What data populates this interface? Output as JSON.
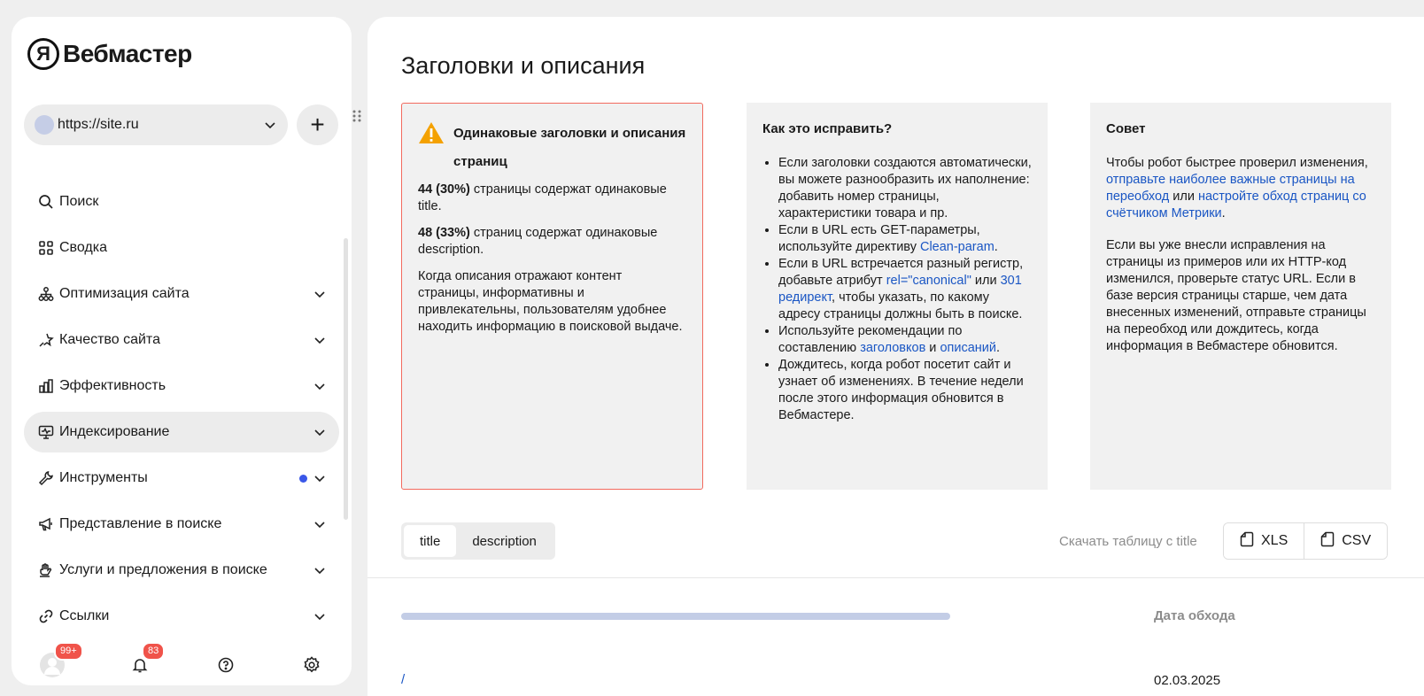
{
  "app": {
    "logo_letter": "Я",
    "logo_text": "Вебмастер"
  },
  "site_select": {
    "url": "https://site.ru",
    "add_label": "+"
  },
  "nav": {
    "items": [
      {
        "label": "Поиск",
        "icon": "search-icon"
      },
      {
        "label": "Сводка",
        "icon": "grid-icon"
      },
      {
        "label": "Оптимизация сайта",
        "icon": "sitemap-icon"
      },
      {
        "label": "Качество сайта",
        "icon": "magic-star-icon"
      },
      {
        "label": "Эффективность",
        "icon": "bar-chart-icon"
      },
      {
        "label": "Индексирование",
        "icon": "monitor-pulse-icon"
      },
      {
        "label": "Инструменты",
        "icon": "wrench-icon"
      },
      {
        "label": "Представление в поиске",
        "icon": "megaphone-icon"
      },
      {
        "label": "Услуги и предложения в поиске",
        "icon": "hand-icon"
      },
      {
        "label": "Ссылки",
        "icon": "link-icon"
      }
    ]
  },
  "bottom_bar": {
    "profile_badge": "99+",
    "notifications_badge": "83"
  },
  "page": {
    "title": "Заголовки и описания"
  },
  "warning_card": {
    "title": "Одинаковые заголовки и описания страниц",
    "stat1_bold": "44 (30%)",
    "stat1_text": " страницы содержат одинаковые title.",
    "stat2_bold": "48 (33%)",
    "stat2_text": " страниц содержат одинаковые description.",
    "body": "Когда описания отражают контент страницы, информативны и привлекательны, пользователям удобнее находить информацию в поисковой выдаче."
  },
  "fix_card": {
    "title": "Как это исправить?",
    "li1": "Если заголовки создаются автоматически, вы можете разнообразить их наполнение: добавить номер страницы, характеристики товара и пр.",
    "li2_a": "Если в URL есть GET-параметры, используйте директиву ",
    "li2_link": "Clean-param",
    "li2_b": ".",
    "li3_a": "Если в URL встречается разный регистр, добавьте атрибут ",
    "li3_link1": "rel=\"canonical\"",
    "li3_b": " или ",
    "li3_link2": "301 редирект",
    "li3_c": ", чтобы указать, по какому адресу страницы должны быть в поиске.",
    "li4_a": "Используйте рекомендации по составлению ",
    "li4_link1": "заголовков",
    "li4_b": " и ",
    "li4_link2": "описаний",
    "li4_c": ".",
    "li5": "Дождитесь, когда робот посетит сайт и узнает об изменениях. В течение недели после этого информация обновится в Вебмастере."
  },
  "tip_card": {
    "title": "Совет",
    "p1_a": "Чтобы робот быстрее проверил изменения, ",
    "p1_link1": "отправьте наиболее важные страницы на переобход",
    "p1_b": " или ",
    "p1_link2": "настройте обход страниц со счётчиком Метрики",
    "p1_c": ".",
    "p2": "Если вы уже внесли исправления на страницы из примеров или их HTTP-код изменился, проверьте статус URL. Если в базе версия страницы старше, чем дата внесенных изменений, отправьте страницы на переобход или дождитесь, когда информация в Вебмастере обновится."
  },
  "table": {
    "tabs": [
      "title",
      "description"
    ],
    "download_label": "Скачать таблицу с title",
    "xls_label": "XLS",
    "csv_label": "CSV",
    "col_date": "Дата обхода",
    "rows": [
      {
        "url": "/",
        "date": "02.03.2025"
      }
    ]
  },
  "colors": {
    "accent_link": "#1a56c4",
    "warning_border": "#f26a5e",
    "badge_red": "#f0534a",
    "dot_blue": "#3a57e8"
  }
}
